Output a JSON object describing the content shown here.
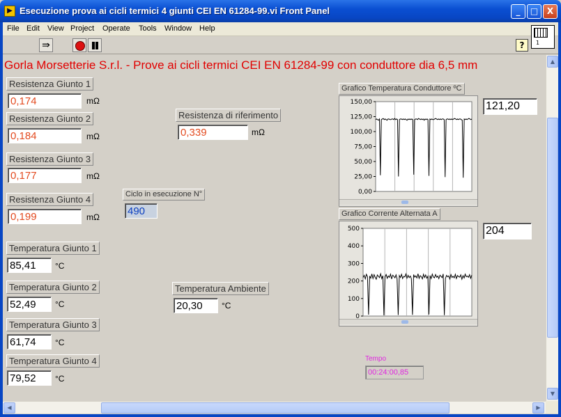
{
  "window": {
    "title": "Esecuzione prova ai cicli termici 4 giunti CEI EN 61284-99.vi Front Panel",
    "icon_name": "labview-vi-icon",
    "controls": [
      "_",
      "□",
      "X"
    ]
  },
  "menu": [
    "File",
    "Edit",
    "View",
    "Project",
    "Operate",
    "Tools",
    "Window",
    "Help"
  ],
  "toolbar": {
    "run_icon": "run-arrow-icon",
    "abort_icon": "abort-stop-icon",
    "pause_icon": "pause-icon",
    "help_label": "?",
    "vi_number": "1"
  },
  "panel": {
    "header": "Gorla Morsetterie S.r.l. - Prove ai cicli termici CEI EN 61284-99 con conduttore dia 6,5    mm",
    "resistances": [
      {
        "label": "Resistenza Giunto 1",
        "value": "0,174",
        "unit": "mΩ"
      },
      {
        "label": "Resistenza Giunto 2",
        "value": "0,184",
        "unit": "mΩ"
      },
      {
        "label": "Resistenza Giunto 3",
        "value": "0,177",
        "unit": "mΩ"
      },
      {
        "label": "Resistenza Giunto 4",
        "value": "0,199",
        "unit": "mΩ"
      }
    ],
    "reference": {
      "label": "Resistenza di riferimento",
      "value": "0,339",
      "unit": "mΩ"
    },
    "cycle": {
      "label": "Ciclo in esecuzione N°",
      "value": "490"
    },
    "temperatures": [
      {
        "label": "Temperatura Giunto 1",
        "value": "85,41",
        "unit": "°C"
      },
      {
        "label": "Temperatura Giunto 2",
        "value": "52,49",
        "unit": "°C"
      },
      {
        "label": "Temperatura Giunto 3",
        "value": "61,74",
        "unit": "°C"
      },
      {
        "label": "Temperatura Giunto 4",
        "value": "79,52",
        "unit": "°C"
      }
    ],
    "ambient": {
      "label": "Temperatura Ambiente",
      "value": "20,30",
      "unit": "°C"
    },
    "tempo": {
      "label": "Tempo",
      "value": "00:24:00,85"
    }
  },
  "graphs": {
    "temperature": {
      "label": "Grafico Temperatura Conduttore ºC",
      "current_value": "121,20"
    },
    "current": {
      "label": "Grafico Corrente Alternata A",
      "current_value": "204"
    }
  },
  "colors": {
    "header": "#e10000",
    "resistance_value": "#e34a1f",
    "cycle_value": "#0a3ec0",
    "tempo": "#e026e0",
    "title_bar": "#0846c4"
  },
  "chart_data": [
    {
      "type": "line",
      "title": "Grafico Temperatura Conduttore ºC",
      "xlabel": "",
      "ylabel": "",
      "ylim": [
        0,
        150
      ],
      "y_ticks": [
        "150,00",
        "125,00",
        "100,00",
        "75,00",
        "50,00",
        "25,00",
        "0,00"
      ],
      "grid": true,
      "series": [
        {
          "values": [
            120,
            121,
            120,
            119,
            121,
            27,
            120,
            121,
            122,
            120,
            121,
            120,
            119,
            121,
            121,
            120,
            120,
            121,
            121,
            120,
            122,
            120,
            121,
            120,
            25,
            120,
            121,
            121,
            120,
            121,
            120,
            121,
            120,
            119,
            121,
            120,
            121,
            120,
            121,
            120,
            28,
            120,
            121,
            121,
            120,
            122,
            121,
            120,
            121,
            120,
            121,
            119,
            121,
            120,
            121,
            120,
            26,
            121,
            120,
            121,
            120,
            120,
            121,
            122,
            121,
            120,
            121,
            120,
            121,
            120,
            121,
            121,
            120,
            24,
            120,
            121,
            121,
            120,
            121,
            120,
            121,
            120,
            121,
            122,
            121,
            120,
            121,
            120,
            121,
            121,
            120,
            119,
            23,
            121,
            120,
            121,
            120,
            121,
            122,
            121,
            120,
            121
          ]
        }
      ]
    },
    {
      "type": "line",
      "title": "Grafico Corrente Alternata A",
      "xlabel": "",
      "ylabel": "",
      "ylim": [
        0,
        500
      ],
      "y_ticks": [
        "500",
        "400",
        "300",
        "200",
        "100",
        "0"
      ],
      "grid": true,
      "series": [
        {
          "values": [
            220,
            232,
            212,
            238,
            225,
            8,
            228,
            216,
            240,
            214,
            236,
            222,
            210,
            234,
            226,
            219,
            241,
            213,
            230,
            4,
            224,
            237,
            215,
            229,
            221,
            239,
            211,
            233,
            227,
            218,
            235,
            212,
            6,
            231,
            220,
            238,
            214,
            226,
            223,
            240,
            216,
            232,
            219,
            228,
            213,
            7,
            236,
            222,
            229,
            217,
            241,
            215,
            230,
            225,
            212,
            238,
            220,
            234,
            216,
            227,
            9,
            231,
            214,
            239,
            223,
            218,
            237,
            221,
            228,
            213,
            233,
            226,
            219,
            240,
            5,
            215,
            232,
            224,
            229,
            211,
            236,
            220,
            227,
            218,
            238,
            214,
            231,
            225,
            222,
            235,
            210,
            230,
            217,
            239,
            224,
            228,
            221,
            236,
            215,
            234
          ]
        }
      ]
    }
  ]
}
